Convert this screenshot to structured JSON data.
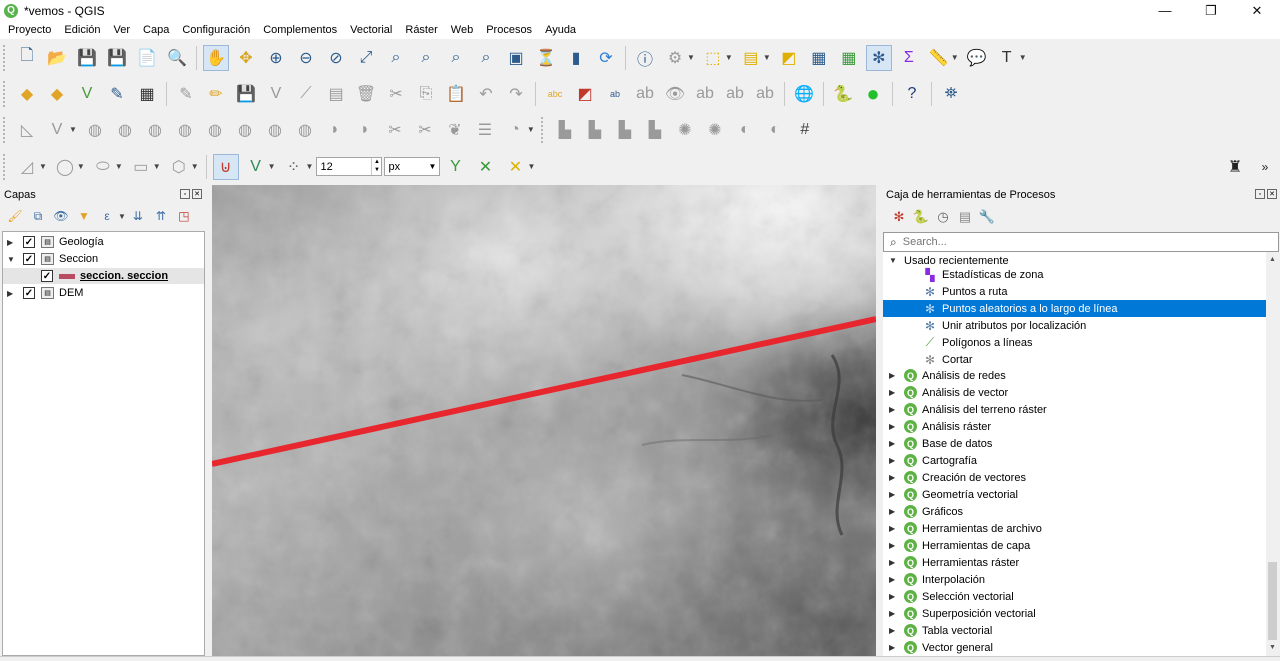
{
  "window": {
    "title": "*vemos - QGIS",
    "minimize": "—",
    "restore": "❐",
    "close": "✕"
  },
  "menu": [
    "Proyecto",
    "Edición",
    "Ver",
    "Capa",
    "Configuración",
    "Complementos",
    "Vectorial",
    "Ráster",
    "Web",
    "Procesos",
    "Ayuda"
  ],
  "digitizing": {
    "snap_tolerance": "12",
    "snap_units": "px"
  },
  "layers_panel": {
    "title": "Capas",
    "layers": [
      {
        "label": "Geología",
        "checked": true,
        "expanded": false
      },
      {
        "label": "Seccion",
        "checked": true,
        "expanded": true
      },
      {
        "label": "seccion. seccion",
        "checked": true,
        "child": true
      },
      {
        "label": "DEM",
        "checked": true,
        "expanded": false
      }
    ]
  },
  "processing_panel": {
    "title": "Caja de herramientas de Procesos",
    "search_placeholder": "Search...",
    "recent_group": "Usado recientemente",
    "recent_items": [
      {
        "label": "Estadísticas de zona",
        "icon": "zonal-stats-icon"
      },
      {
        "label": "Puntos a ruta",
        "icon": "gear-icon"
      },
      {
        "label": "Puntos aleatorios a lo largo de línea",
        "icon": "gear-icon",
        "selected": true
      },
      {
        "label": "Unir atributos por localización",
        "icon": "gear-icon"
      },
      {
        "label": "Polígonos a líneas",
        "icon": "polygon-to-lines-icon"
      },
      {
        "label": "Cortar",
        "icon": "clip-icon"
      }
    ],
    "providers": [
      "Análisis de redes",
      "Análisis de vector",
      "Análisis del terreno ráster",
      "Análisis ráster",
      "Base de datos",
      "Cartografía",
      "Creación de vectores",
      "Geometría vectorial",
      "Gráficos",
      "Herramientas de archivo",
      "Herramientas de capa",
      "Herramientas ráster",
      "Interpolación",
      "Selección vectorial",
      "Superposición vectorial",
      "Tabla vectorial",
      "Vector general"
    ]
  },
  "colors": {
    "section_line": "#e8262e",
    "selection": "#0078d7",
    "qgis_green": "#5db244"
  }
}
